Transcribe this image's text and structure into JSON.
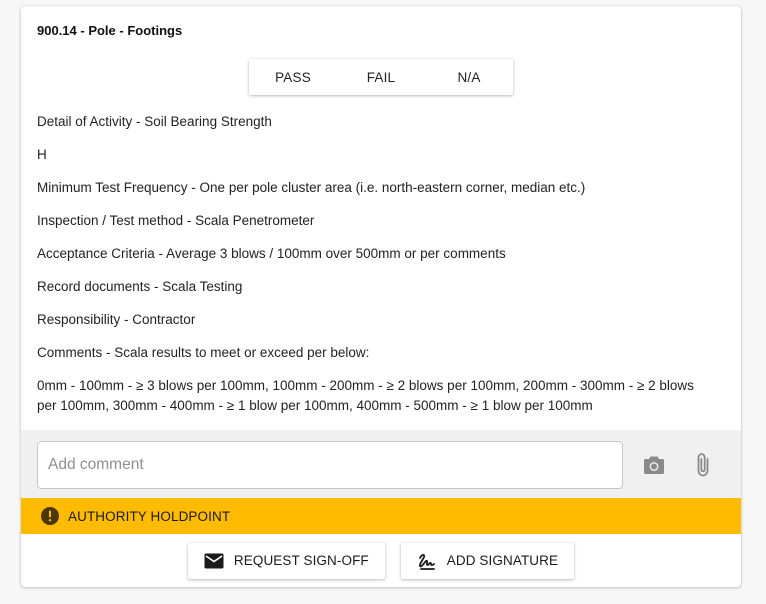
{
  "item": {
    "title": "900.14 - Pole - Footings"
  },
  "result_toggle": {
    "options": [
      "PASS",
      "FAIL",
      "N/A"
    ]
  },
  "details": [
    "Detail of Activity - Soil Bearing Strength",
    "H",
    "Minimum Test Frequency - One per pole cluster area (i.e. north-eastern corner, median etc.)",
    "Inspection / Test method - Scala Penetrometer",
    "Acceptance Criteria - Average 3 blows / 100mm over 500mm or per comments",
    "Record documents - Scala Testing",
    "Responsibility - Contractor",
    "Comments - Scala results to meet or exceed per below:",
    "0mm - 100mm - ≥ 3 blows per 100mm, 100mm - 200mm - ≥ 2 blows per 100mm, 200mm - 300mm - ≥ 2 blows per 100mm, 300mm - 400mm - ≥ 1 blow per 100mm, 400mm - 500mm - ≥ 1 blow per 100mm"
  ],
  "comment": {
    "value": "",
    "placeholder": "Add comment",
    "camera_icon": "camera-icon",
    "attach_icon": "paperclip-icon"
  },
  "holdpoint": {
    "label": "AUTHORITY HOLDPOINT",
    "icon": "exclamation-circle-icon",
    "color": "#ffbb00"
  },
  "actions": {
    "request_signoff_label": "REQUEST SIGN-OFF",
    "request_signoff_icon": "envelope-icon",
    "add_signature_label": "ADD SIGNATURE",
    "add_signature_icon": "signature-icon"
  }
}
